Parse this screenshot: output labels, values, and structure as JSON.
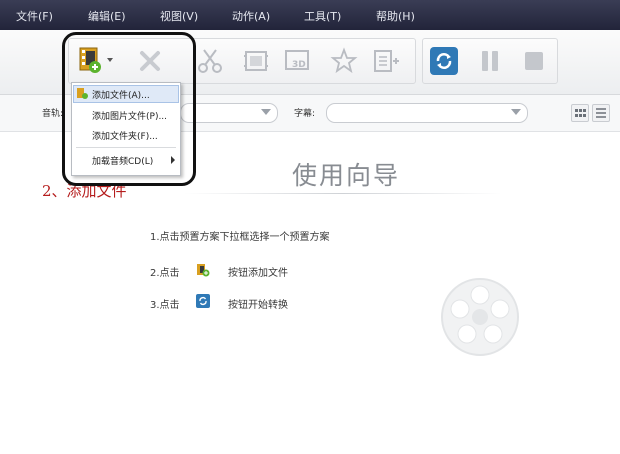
{
  "menubar": {
    "items": [
      "文件(F)",
      "编辑(E)",
      "视图(V)",
      "动作(A)",
      "工具(T)",
      "帮助(H)"
    ]
  },
  "toolbar": {
    "buttons": [
      {
        "name": "add-file-button",
        "icon": "film-add-icon",
        "enabled": true
      },
      {
        "name": "delete-button",
        "icon": "close-icon",
        "enabled": false
      },
      {
        "name": "cut-button",
        "icon": "scissors-icon",
        "enabled": false
      },
      {
        "name": "crop-button",
        "icon": "crop-icon",
        "enabled": false
      },
      {
        "name": "3d-button",
        "icon": "3d-icon",
        "enabled": false
      },
      {
        "name": "effect-button",
        "icon": "star-icon",
        "enabled": false
      },
      {
        "name": "merge-button",
        "icon": "merge-icon",
        "enabled": false
      },
      {
        "name": "convert-button",
        "icon": "convert-icon",
        "enabled": true
      },
      {
        "name": "pause-button",
        "icon": "pause-icon",
        "enabled": false
      },
      {
        "name": "stop-button",
        "icon": "stop-icon",
        "enabled": false
      }
    ]
  },
  "options": {
    "audio_label": "音轨:",
    "subtitle_label": "字幕:"
  },
  "dropdown": {
    "items": [
      "添加文件(A)...",
      "添加图片文件(P)...",
      "添加文件夹(F)...",
      "加载音频CD(L)"
    ]
  },
  "annotation": "2、添加文件",
  "guide": {
    "title": "使用向导",
    "step1": "1.点击预置方案下拉框选择一个预置方案",
    "step2_prefix": "2.点击",
    "step2_suffix": "按钮添加文件",
    "step3_prefix": "3.点击",
    "step3_suffix": "按钮开始转换"
  },
  "colors": {
    "menubar": "#2b2d44",
    "annotation": "#b51c1c",
    "convert_blue": "#2f79b6",
    "add_green": "#5cb32e",
    "film_orange": "#d9a020"
  }
}
